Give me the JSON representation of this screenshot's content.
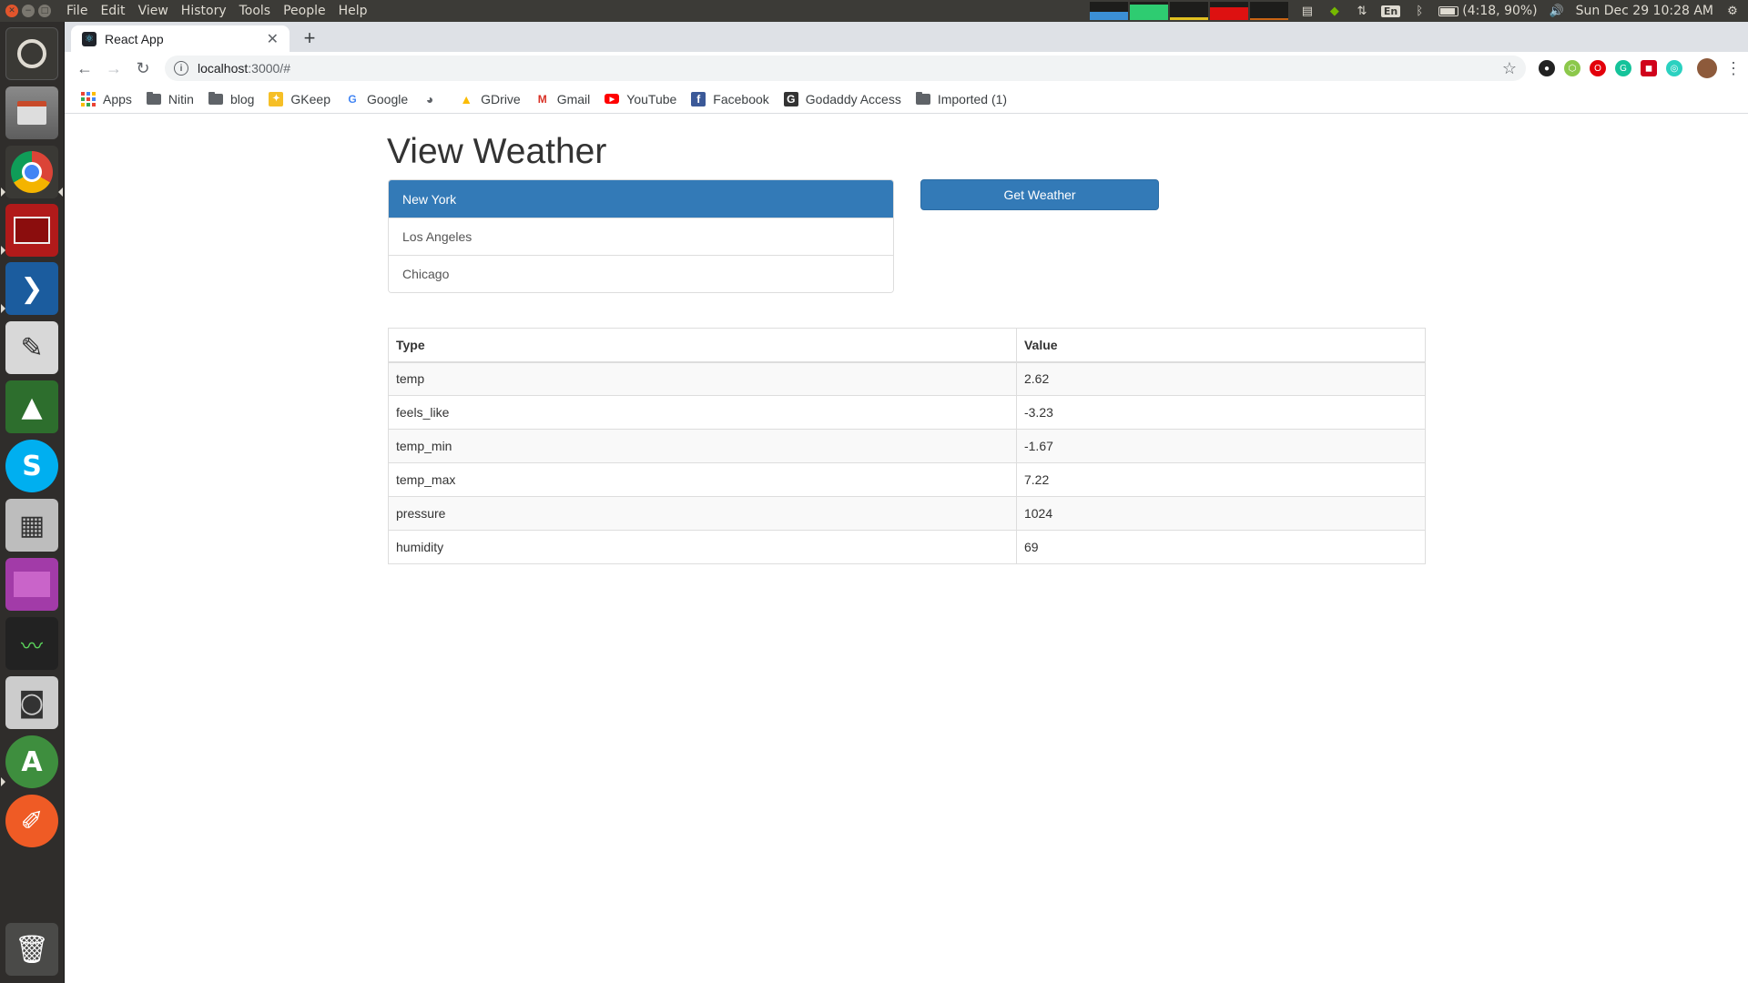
{
  "system": {
    "menu": [
      "File",
      "Edit",
      "View",
      "History",
      "Tools",
      "People",
      "Help"
    ],
    "battery": "(4:18, 90%)",
    "lang": "En",
    "clock": "Sun Dec 29 10:28 AM"
  },
  "launcher": {
    "items": [
      "dash",
      "files",
      "chrome",
      "terminal",
      "vscode",
      "text-editor",
      "robomongo",
      "skype",
      "calculator",
      "workspace",
      "system-monitor",
      "screenshot",
      "software-updater",
      "postman",
      "trash"
    ]
  },
  "browser": {
    "tab_title": "React App",
    "url_host": "localhost",
    "url_path": ":3000/#",
    "bookmarks": [
      "Apps",
      "Nitin",
      "blog",
      "GKeep",
      "Google",
      "",
      "GDrive",
      "Gmail",
      "YouTube",
      "Facebook",
      "Godaddy Access",
      "Imported (1)"
    ]
  },
  "page": {
    "title": "View Weather",
    "cities": [
      "New York",
      "Los Angeles",
      "Chicago"
    ],
    "selected_city": "New York",
    "button_label": "Get Weather",
    "table": {
      "headers": [
        "Type",
        "Value"
      ],
      "rows": [
        [
          "temp",
          "2.62"
        ],
        [
          "feels_like",
          "-3.23"
        ],
        [
          "temp_min",
          "-1.67"
        ],
        [
          "temp_max",
          "7.22"
        ],
        [
          "pressure",
          "1024"
        ],
        [
          "humidity",
          "69"
        ]
      ]
    }
  },
  "colors": {
    "primary": "#337ab7",
    "topbar": "#3c3b37",
    "launcher": "#2f2d2b"
  }
}
